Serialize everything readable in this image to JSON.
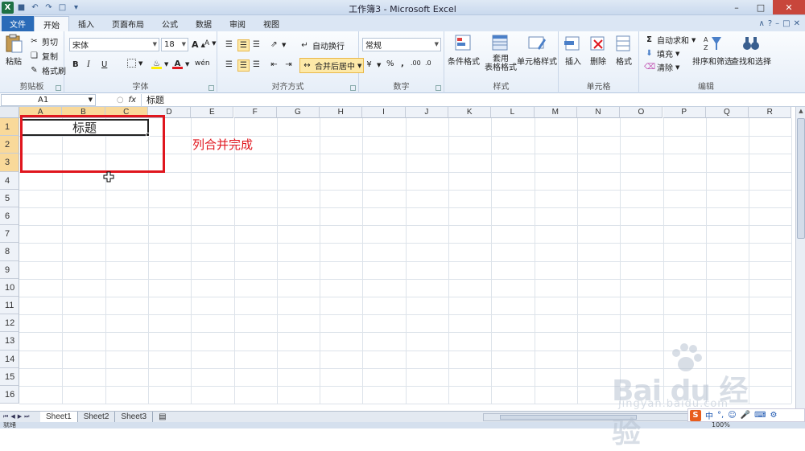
{
  "window": {
    "title": "工作簿3 - Microsoft Excel"
  },
  "qat": {
    "app_icon": "X"
  },
  "tabs": {
    "file": "文件",
    "home": "开始",
    "insert": "插入",
    "layout": "页面布局",
    "formulas": "公式",
    "data": "数据",
    "review": "审阅",
    "view": "视图"
  },
  "clipboard": {
    "paste": "粘贴",
    "cut": "剪切",
    "copy": "复制",
    "format_painter": "格式刷",
    "group": "剪贴板"
  },
  "font": {
    "name": "宋体",
    "size": "18",
    "bold": "B",
    "italic": "I",
    "underline": "U",
    "font_color": "A",
    "phonetic": "wén",
    "group": "字体"
  },
  "alignment": {
    "wrap_text": "自动换行",
    "merge_center": "合并后居中",
    "group": "对齐方式"
  },
  "number": {
    "format": "常规",
    "percent": "%",
    "comma": ",",
    "group": "数字"
  },
  "styles": {
    "conditional": "条件格式",
    "table_line1": "套用",
    "table_line2": "表格格式",
    "cell_styles": "单元格样式",
    "group": "样式"
  },
  "cells": {
    "insert": "插入",
    "delete": "删除",
    "format": "格式",
    "group": "单元格"
  },
  "editing": {
    "autosum": "自动求和",
    "fill": "填充",
    "clear": "清除",
    "sort": "排序和筛选",
    "find": "查找和选择",
    "group": "编辑"
  },
  "formula_bar": {
    "name_box": "A1",
    "fx": "fx",
    "content": "标题"
  },
  "columns": [
    "A",
    "B",
    "C",
    "D",
    "E",
    "F",
    "G",
    "H",
    "I",
    "J",
    "K",
    "L",
    "M",
    "N",
    "O",
    "P",
    "Q",
    "R"
  ],
  "rows": [
    "1",
    "2",
    "3",
    "4",
    "5",
    "6",
    "7",
    "8",
    "9",
    "10",
    "11",
    "12",
    "13",
    "14",
    "15",
    "16"
  ],
  "cell_a1": "标题",
  "annotation": "列合并完成",
  "sheets": [
    "Sheet1",
    "Sheet2",
    "Sheet3"
  ],
  "status": {
    "ready": "就绪",
    "zoom": "100%"
  },
  "watermark": {
    "brand": "Bai du 经验",
    "url": "jingyan.baidu.com"
  },
  "ime": {
    "logo": "S",
    "mode": "中"
  },
  "colors": {
    "accent": "#e0161e",
    "selected_header": "#f9d99a",
    "file_tab": "#2a6bb8"
  }
}
